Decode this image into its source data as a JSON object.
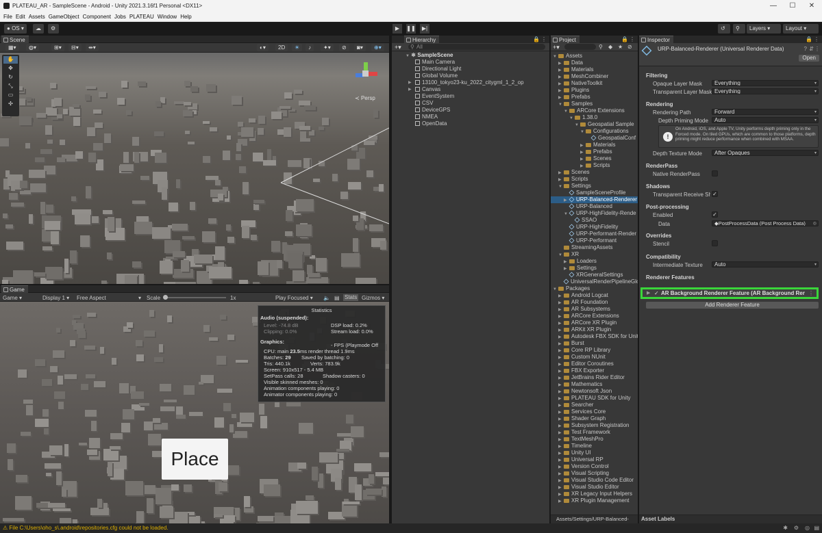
{
  "window": {
    "title": "PLATEAU_AR - SampleScene - Android - Unity 2021.3.16f1 Personal <DX11>"
  },
  "menu": [
    "File",
    "Edit",
    "Assets",
    "GameObject",
    "Component",
    "Jobs",
    "PLATEAU",
    "Window",
    "Help"
  ],
  "toolbar": {
    "account": "OS",
    "layers": "Layers",
    "layout": "Layout"
  },
  "scene": {
    "tab": "Scene",
    "mode2d": "2D",
    "persp": "Persp"
  },
  "game": {
    "tab": "Game",
    "display_mode": "Game",
    "display": "Display 1",
    "aspect": "Free Aspect",
    "scale_label": "Scale",
    "scale_value": "1x",
    "play_focused": "Play Focused",
    "stats": "Stats",
    "gizmos": "Gizmos",
    "place_button": "Place"
  },
  "stats": {
    "title": "Statistics",
    "audio_header": "Audio (suspended):",
    "level": "Level: -74.8 dB",
    "clipping": "Clipping: 0.0%",
    "dsp": "DSP load: 0.2%",
    "stream": "Stream load: 0.0%",
    "graphics_header": "Graphics:",
    "fps": "- FPS (Playmode Off",
    "cpu_prefix": "CPU: main ",
    "cpu_main": "23.5",
    "cpu_suffix": "ms  render thread 1.9ms",
    "batches_prefix": "Batches: ",
    "batches": "29",
    "saved": "Saved by batching: 0",
    "tris": "Tris: 440.1k",
    "verts": "Verts: 783.9k",
    "screen": "Screen: 910x517 - 5.4 MB",
    "setpass": "SetPass calls: 28",
    "shadow": "Shadow casters: 0",
    "skinned": "Visible skinned meshes: 0",
    "anim_play": "Animation components playing: 0",
    "animator_play": "Animator components playing: 0"
  },
  "hierarchy": {
    "tab": "Hierarchy",
    "search_placeholder": "All",
    "scene_name": "SampleScene",
    "items": [
      "Main Camera",
      "Directional Light",
      "Global Volume",
      "13100_tokyo23-ku_2022_citygml_1_2_op",
      "Canvas",
      "EventSystem",
      "CSV",
      "DeviceGPS",
      "NMEA",
      "OpenData"
    ]
  },
  "project": {
    "tab": "Project",
    "path": "Assets/Settings/URP-Balanced-",
    "items": [
      {
        "d": 0,
        "t": "Assets",
        "i": "folder",
        "o": "open"
      },
      {
        "d": 1,
        "t": "Data",
        "i": "folder",
        "o": "closed"
      },
      {
        "d": 1,
        "t": "Materials",
        "i": "folder",
        "o": "closed"
      },
      {
        "d": 1,
        "t": "MeshCombiner",
        "i": "folder",
        "o": "closed"
      },
      {
        "d": 1,
        "t": "NativeToolkit",
        "i": "folder",
        "o": "closed"
      },
      {
        "d": 1,
        "t": "Plugins",
        "i": "folder",
        "o": "closed"
      },
      {
        "d": 1,
        "t": "Prefabs",
        "i": "folder",
        "o": "closed"
      },
      {
        "d": 1,
        "t": "Samples",
        "i": "folder",
        "o": "open"
      },
      {
        "d": 2,
        "t": "ARCore Extensions",
        "i": "folder",
        "o": "open"
      },
      {
        "d": 3,
        "t": "1.38.0",
        "i": "folder",
        "o": "open"
      },
      {
        "d": 4,
        "t": "Geospatial Sample",
        "i": "folder",
        "o": "open"
      },
      {
        "d": 5,
        "t": "Configurations",
        "i": "folder",
        "o": "open"
      },
      {
        "d": 6,
        "t": "GeospatialConf",
        "i": "asset",
        "o": ""
      },
      {
        "d": 5,
        "t": "Materials",
        "i": "folder",
        "o": "closed"
      },
      {
        "d": 5,
        "t": "Prefabs",
        "i": "folder",
        "o": "closed"
      },
      {
        "d": 5,
        "t": "Scenes",
        "i": "folder",
        "o": "closed"
      },
      {
        "d": 5,
        "t": "Scripts",
        "i": "folder",
        "o": "closed"
      },
      {
        "d": 1,
        "t": "Scenes",
        "i": "folder",
        "o": "closed"
      },
      {
        "d": 1,
        "t": "Scripts",
        "i": "folder",
        "o": "closed"
      },
      {
        "d": 1,
        "t": "Settings",
        "i": "folder",
        "o": "open"
      },
      {
        "d": 2,
        "t": "SampleSceneProfile",
        "i": "asset",
        "o": ""
      },
      {
        "d": 2,
        "t": "URP-Balanced-Renderer",
        "i": "asset",
        "o": "closed",
        "sel": true
      },
      {
        "d": 2,
        "t": "URP-Balanced",
        "i": "asset",
        "o": ""
      },
      {
        "d": 2,
        "t": "URP-HighFidelity-Rende",
        "i": "asset",
        "o": "open"
      },
      {
        "d": 3,
        "t": "SSAO",
        "i": "asset",
        "o": ""
      },
      {
        "d": 2,
        "t": "URP-HighFidelity",
        "i": "asset",
        "o": ""
      },
      {
        "d": 2,
        "t": "URP-Performant-Render",
        "i": "asset",
        "o": ""
      },
      {
        "d": 2,
        "t": "URP-Performant",
        "i": "asset",
        "o": ""
      },
      {
        "d": 1,
        "t": "StreamingAssets",
        "i": "folder",
        "o": ""
      },
      {
        "d": 1,
        "t": "XR",
        "i": "folder",
        "o": "open"
      },
      {
        "d": 2,
        "t": "Loaders",
        "i": "folder",
        "o": "closed"
      },
      {
        "d": 2,
        "t": "Settings",
        "i": "folder",
        "o": "closed"
      },
      {
        "d": 2,
        "t": "XRGeneralSettings",
        "i": "asset",
        "o": ""
      },
      {
        "d": 1,
        "t": "UniversalRenderPipelineGlo",
        "i": "asset",
        "o": ""
      },
      {
        "d": 0,
        "t": "Packages",
        "i": "folder",
        "o": "open"
      },
      {
        "d": 1,
        "t": "Android Logcat",
        "i": "folder",
        "o": "closed"
      },
      {
        "d": 1,
        "t": "AR Foundation",
        "i": "folder",
        "o": "closed"
      },
      {
        "d": 1,
        "t": "AR Subsystems",
        "i": "folder",
        "o": "closed"
      },
      {
        "d": 1,
        "t": "ARCore Extensions",
        "i": "folder",
        "o": "closed"
      },
      {
        "d": 1,
        "t": "ARCore XR Plugin",
        "i": "folder",
        "o": "closed"
      },
      {
        "d": 1,
        "t": "ARKit XR Plugin",
        "i": "folder",
        "o": "closed"
      },
      {
        "d": 1,
        "t": "Autodesk FBX SDK for Unity",
        "i": "folder",
        "o": "closed"
      },
      {
        "d": 1,
        "t": "Burst",
        "i": "folder",
        "o": "closed"
      },
      {
        "d": 1,
        "t": "Core RP Library",
        "i": "folder",
        "o": "closed"
      },
      {
        "d": 1,
        "t": "Custom NUnit",
        "i": "folder",
        "o": "closed"
      },
      {
        "d": 1,
        "t": "Editor Coroutines",
        "i": "folder",
        "o": "closed"
      },
      {
        "d": 1,
        "t": "FBX Exporter",
        "i": "folder",
        "o": "closed"
      },
      {
        "d": 1,
        "t": "JetBrains Rider Editor",
        "i": "folder",
        "o": "closed"
      },
      {
        "d": 1,
        "t": "Mathematics",
        "i": "folder",
        "o": "closed"
      },
      {
        "d": 1,
        "t": "Newtonsoft Json",
        "i": "folder",
        "o": "closed"
      },
      {
        "d": 1,
        "t": "PLATEAU SDK for Unity",
        "i": "folder",
        "o": "closed"
      },
      {
        "d": 1,
        "t": "Searcher",
        "i": "folder",
        "o": "closed"
      },
      {
        "d": 1,
        "t": "Services Core",
        "i": "folder",
        "o": "closed"
      },
      {
        "d": 1,
        "t": "Shader Graph",
        "i": "folder",
        "o": "closed"
      },
      {
        "d": 1,
        "t": "Subsystem Registration",
        "i": "folder",
        "o": "closed"
      },
      {
        "d": 1,
        "t": "Test Framework",
        "i": "folder",
        "o": "closed"
      },
      {
        "d": 1,
        "t": "TextMeshPro",
        "i": "folder",
        "o": "closed"
      },
      {
        "d": 1,
        "t": "Timeline",
        "i": "folder",
        "o": "closed"
      },
      {
        "d": 1,
        "t": "Unity UI",
        "i": "folder",
        "o": "closed"
      },
      {
        "d": 1,
        "t": "Universal RP",
        "i": "folder",
        "o": "closed"
      },
      {
        "d": 1,
        "t": "Version Control",
        "i": "folder",
        "o": "closed"
      },
      {
        "d": 1,
        "t": "Visual Scripting",
        "i": "folder",
        "o": "closed"
      },
      {
        "d": 1,
        "t": "Visual Studio Code Editor",
        "i": "folder",
        "o": "closed"
      },
      {
        "d": 1,
        "t": "Visual Studio Editor",
        "i": "folder",
        "o": "closed"
      },
      {
        "d": 1,
        "t": "XR Legacy Input Helpers",
        "i": "folder",
        "o": "closed"
      },
      {
        "d": 1,
        "t": "XR Plugin Management",
        "i": "folder",
        "o": "closed"
      }
    ]
  },
  "inspector": {
    "tab": "Inspector",
    "object_title": "URP-Balanced-Renderer (Universal Renderer Data)",
    "open_button": "Open",
    "filtering": "Filtering",
    "opaque_mask_label": "Opaque Layer Mask",
    "opaque_mask_value": "Everything",
    "transparent_mask_label": "Transparent Layer Mask",
    "transparent_mask_value": "Everything",
    "rendering": "Rendering",
    "path_label": "Rendering Path",
    "path_value": "Forward",
    "priming_label": "Depth Priming Mode",
    "priming_value": "Auto",
    "priming_info": "On Android, iOS, and Apple TV, Unity performs depth priming only in the Forced mode. On tiled GPUs, which are common to those platforms, depth priming might reduce performance when combined with MSAA.",
    "depth_texture_label": "Depth Texture Mode",
    "depth_texture_value": "After Opaques",
    "renderpass": "RenderPass",
    "native_rp_label": "Native RenderPass",
    "shadows": "Shadows",
    "transparent_shadows_label": "Transparent Receive Sh",
    "postprocessing": "Post-processing",
    "enabled_label": "Enabled",
    "data_label": "Data",
    "data_value": "PostProcessData (Post Process Data)",
    "overrides": "Overrides",
    "stencil_label": "Stencil",
    "compatibility": "Compatibility",
    "intermediate_label": "Intermediate Texture",
    "intermediate_value": "Auto",
    "renderer_features": "Renderer Features",
    "feature_name": "AR Background Renderer Feature (AR Background Rende",
    "add_feature": "Add Renderer Feature",
    "asset_labels": "Asset Labels"
  },
  "status": {
    "message": "File C:\\Users\\oho_s\\.android\\repositories.cfg could not be loaded."
  },
  "colors": {
    "highlight": "#3ad63a",
    "selection": "#2c5d87",
    "accent": "#4d8fd1"
  }
}
